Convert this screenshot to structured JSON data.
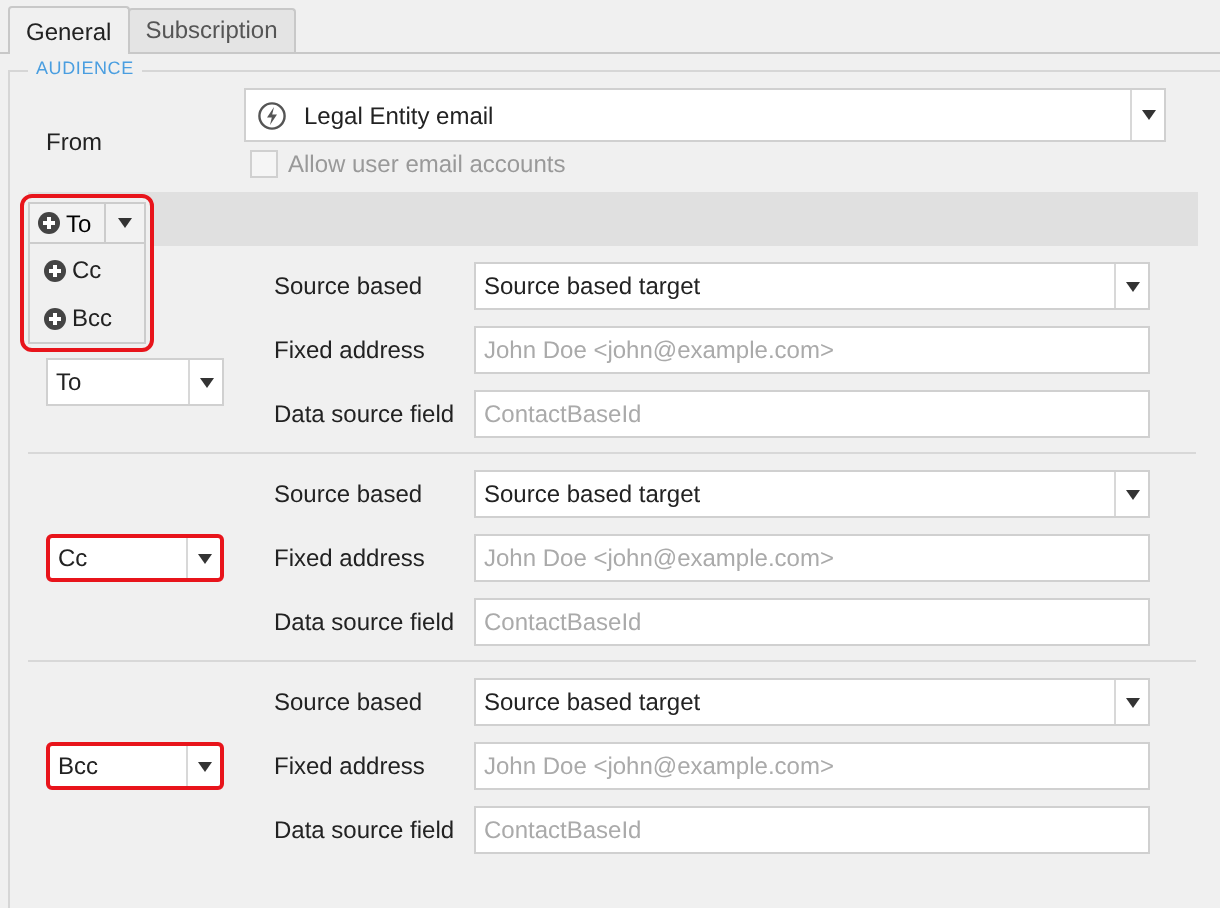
{
  "tabs": [
    {
      "label": "General",
      "selected": true
    },
    {
      "label": "Subscription",
      "selected": false
    }
  ],
  "section": {
    "legend": "AUDIENCE"
  },
  "from": {
    "label": "From",
    "value": "Legal Entity email",
    "allow_user": {
      "label": "Allow user email accounts",
      "checked": false,
      "disabled": true
    }
  },
  "add_button": {
    "label": "To",
    "highlighted": true,
    "menu": [
      {
        "label": "Cc"
      },
      {
        "label": "Bcc"
      }
    ]
  },
  "recipients": [
    {
      "type": "To",
      "highlighted": false,
      "source_label": "Source based",
      "source_value": "Source based target",
      "fixed_label": "Fixed address",
      "fixed_placeholder": "John Doe <john@example.com>",
      "data_label": "Data source field",
      "data_placeholder": "ContactBaseId"
    },
    {
      "type": "Cc",
      "highlighted": true,
      "source_label": "Source based",
      "source_value": "Source based target",
      "fixed_label": "Fixed address",
      "fixed_placeholder": "John Doe <john@example.com>",
      "data_label": "Data source field",
      "data_placeholder": "ContactBaseId"
    },
    {
      "type": "Bcc",
      "highlighted": true,
      "source_label": "Source based",
      "source_value": "Source based target",
      "fixed_label": "Fixed address",
      "fixed_placeholder": "John Doe <john@example.com>",
      "data_label": "Data source field",
      "data_placeholder": "ContactBaseId"
    }
  ]
}
